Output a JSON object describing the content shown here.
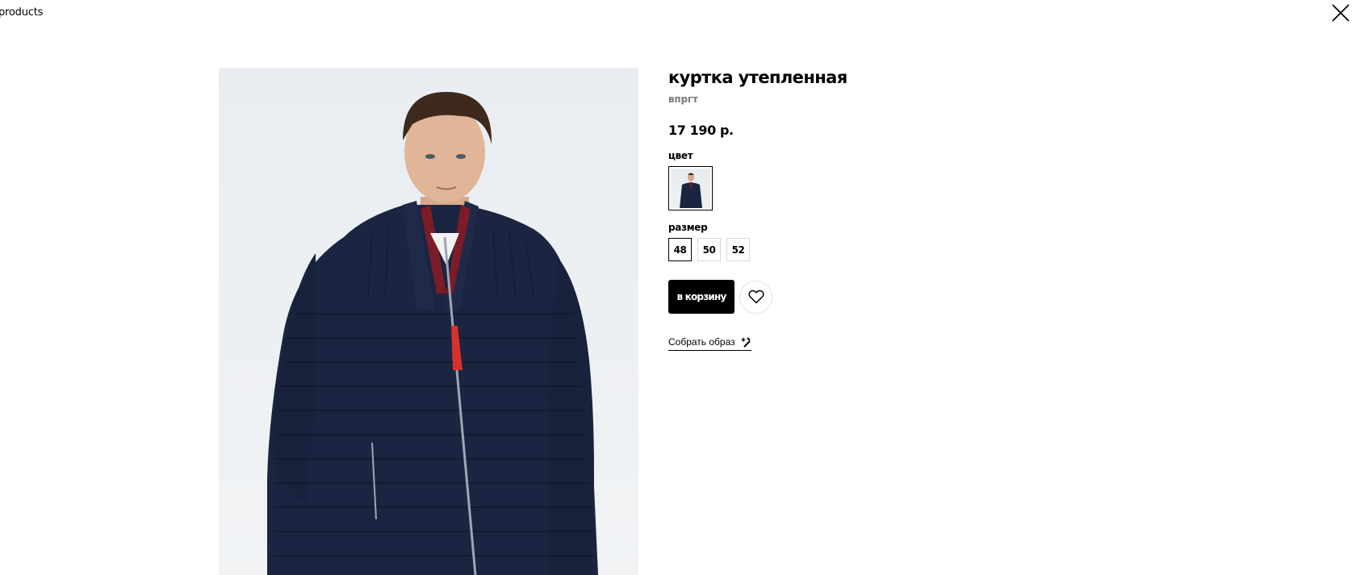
{
  "nav": {
    "back_label": "products",
    "close_icon": "close-icon"
  },
  "product": {
    "title": "куртка утепленная",
    "article": "впргт",
    "price": "17 190 р.",
    "color_label": "цвет",
    "size_label": "размер",
    "sizes": [
      "48",
      "50",
      "52"
    ],
    "selected_size": "48",
    "add_to_cart_label": "в корзину",
    "wishlist_icon": "heart-icon",
    "look_label": "Собрать образ",
    "look_icon": "magic-wand-icon"
  },
  "colors": {
    "accent": "#000000",
    "article_text": "#7a7a7a",
    "jacket": "#1b2440",
    "collar": "#7b1c27",
    "zip_pull": "#d7312b"
  }
}
